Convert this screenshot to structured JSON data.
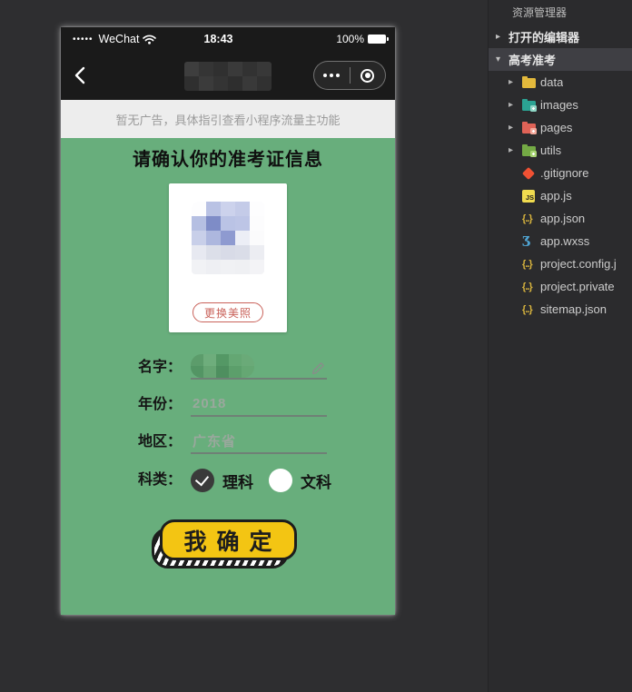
{
  "explorer": {
    "title": "资源管理器",
    "sections": [
      {
        "label": "打开的编辑器",
        "state": "collapsed",
        "selected": false
      },
      {
        "label": "高考准考",
        "state": "expanded",
        "selected": true
      }
    ],
    "icon_glyphs": {
      "collapsed": "▸",
      "expanded": "▾",
      "js": "JS",
      "json": "{..}",
      "wxss": "Ʒ"
    },
    "tree": [
      {
        "name": "data",
        "type": "folder",
        "color": "#e3b93c"
      },
      {
        "name": "images",
        "type": "folder",
        "color": "#2ba393",
        "badge": "#8fd6c6"
      },
      {
        "name": "pages",
        "type": "folder",
        "color": "#e06357",
        "badge": "#f2a89b"
      },
      {
        "name": "utils",
        "type": "folder",
        "color": "#74aa45",
        "badge": "#a8d474"
      },
      {
        "name": ".gitignore",
        "type": "git"
      },
      {
        "name": "app.js",
        "type": "js"
      },
      {
        "name": "app.json",
        "type": "json"
      },
      {
        "name": "app.wxss",
        "type": "wxss"
      },
      {
        "name": "project.config.j",
        "type": "json"
      },
      {
        "name": "project.private",
        "type": "json"
      },
      {
        "name": "sitemap.json",
        "type": "json"
      }
    ]
  },
  "simulator": {
    "status": {
      "signal": "•••••",
      "carrier": "WeChat",
      "time": "18:43",
      "battery": "100%"
    },
    "ad_banner": "暂无广告，具体指引查看小程序流量主功能",
    "page_title": "请确认你的准考证信息",
    "photo_card": {
      "change_button": "更换美照"
    },
    "form": {
      "name_label": "名字：",
      "year_label": "年份：",
      "year_value": "2018",
      "region_label": "地区：",
      "region_value": "广东省",
      "category_label": "科类：",
      "options": [
        {
          "label": "理科",
          "checked": true
        },
        {
          "label": "文科",
          "checked": false
        }
      ]
    },
    "confirm_button": "我确定"
  },
  "colors": {
    "green_bg": "#68ae7c",
    "button_yellow": "#f3c513",
    "accent_red": "#c9625a",
    "dark_bar": "#1a1a1a",
    "banner_bg": "#ededed",
    "selected_row": "#3f3f44"
  },
  "mosaics": {
    "nav_title": [
      "#3e3e3e",
      "#353535",
      "#303030",
      "#3a3a3a",
      "#323232",
      "#383838",
      "#2f2f2f",
      "#3b3b3b",
      "#343434",
      "#2e2e2e",
      "#393939",
      "#313131"
    ],
    "photo": [
      "#fdfdfe",
      "#b9c2e4",
      "#ccd2ec",
      "#c4cbe8",
      "#fdfdfe",
      "#b5bfe2",
      "#7e8cc7",
      "#bac3e5",
      "#bdc5e6",
      "#fcfcfd",
      "#c8cfe9",
      "#adb7de",
      "#8e9ad0",
      "#eceef6",
      "#fbfbfc",
      "#e7e9f1",
      "#dcdfe9",
      "#d8dbe7",
      "#dadde8",
      "#ecedf2",
      "#f1f2f5",
      "#eeeff3",
      "#f0f1f4",
      "#eff0f3",
      "#f3f3f6"
    ],
    "name": [
      "#5c9c6b",
      "#6ead7c",
      "#549865",
      "#64a773",
      "#6aaa78",
      "#539564",
      "#66a573",
      "#4e8f5f",
      "#5c9f6b",
      "#65a773"
    ]
  }
}
